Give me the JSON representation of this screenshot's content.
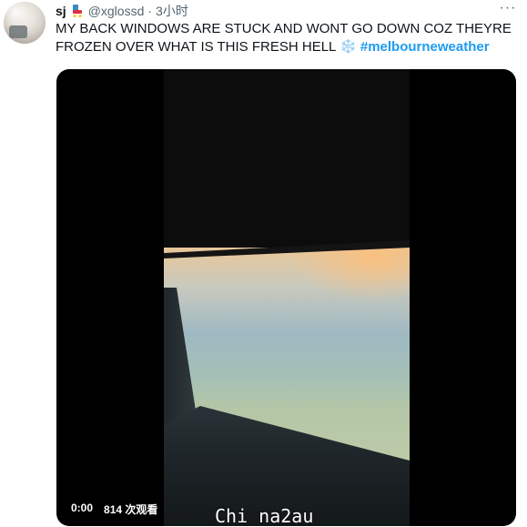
{
  "tweet": {
    "author_name": "sj",
    "handle": "@xglossd",
    "separator": "·",
    "time": "3小时",
    "text_main": "MY BACK WINDOWS ARE STUCK AND WONT GO DOWN COZ THEYRE FROZEN OVER WHAT IS THIS FRESH HELL ",
    "snow_emoji": "❄️",
    "hashtag": "#melbourneweather",
    "more_label": "···"
  },
  "video": {
    "time": "0:00",
    "views": "814 次观看"
  },
  "watermark": "Chi na2au",
  "colors": {
    "hashtag": "#1d9bf0",
    "muted": "#536471"
  }
}
